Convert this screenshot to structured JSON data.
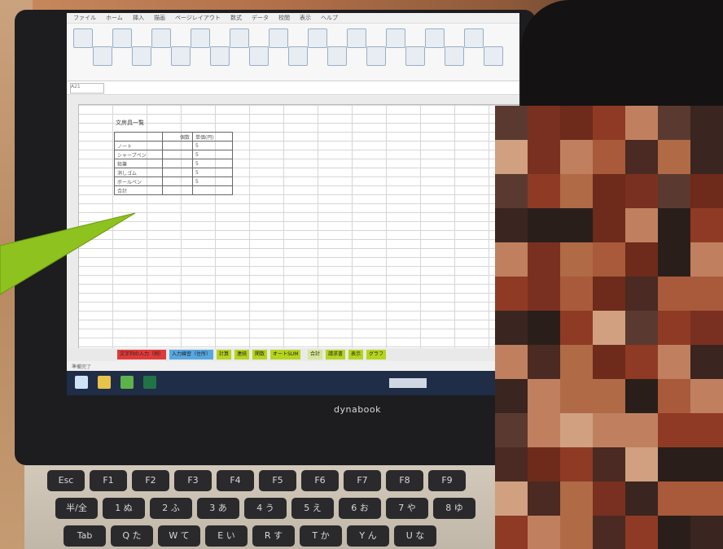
{
  "screen": {
    "ribbon_tabs": [
      "ファイル",
      "ホーム",
      "挿入",
      "描画",
      "ページレイアウト",
      "数式",
      "データ",
      "校閲",
      "表示",
      "ヘルプ"
    ],
    "name_box": "A21",
    "table": {
      "title": "文房具一覧",
      "header": [
        "",
        "個数",
        "単価(円)"
      ],
      "rows": [
        [
          "ノート",
          "",
          "5"
        ],
        [
          "シャープペン",
          "",
          "5"
        ],
        [
          "鉛筆",
          "",
          "5"
        ],
        [
          "消しゴム",
          "",
          "5"
        ],
        [
          "ボールペン",
          "",
          "5"
        ],
        [
          "合計",
          "",
          ""
        ]
      ]
    },
    "sheet_tabs": [
      {
        "label": "文字列の入力（例）",
        "color": "#e03a3a"
      },
      {
        "label": "入力練習（住所）",
        "color": "#57a7e0"
      },
      {
        "label": "計算",
        "color": "#b5d41e"
      },
      {
        "label": "連続",
        "color": "#b5d41e"
      },
      {
        "label": "関数",
        "color": "#b5d41e"
      },
      {
        "label": "オートSUM",
        "color": "#b5d41e"
      },
      {
        "label": "合計",
        "color": "#d5e59a"
      },
      {
        "label": "請求書",
        "color": "#b5d41e"
      },
      {
        "label": "表示",
        "color": "#b5d41e"
      },
      {
        "label": "グラフ",
        "color": "#b5d41e"
      }
    ],
    "status_text": "準備完了"
  },
  "laptop": {
    "brand": "dynabook",
    "keys_row1": [
      "Esc",
      "F1",
      "F2",
      "F3",
      "F4",
      "F5",
      "F6",
      "F7",
      "F8",
      "F9"
    ],
    "keys_row2": [
      "半/全",
      "1 ぬ",
      "2 ふ",
      "3 あ",
      "4 う",
      "5 え",
      "6 お",
      "7 や",
      "8 ゆ"
    ],
    "keys_row3": [
      "Tab",
      "Q た",
      "W て",
      "E い",
      "R す",
      "T か",
      "Y ん",
      "U な"
    ]
  },
  "colors": {
    "arrow": "#8dc21f",
    "taskbar": "#1f2d46"
  }
}
